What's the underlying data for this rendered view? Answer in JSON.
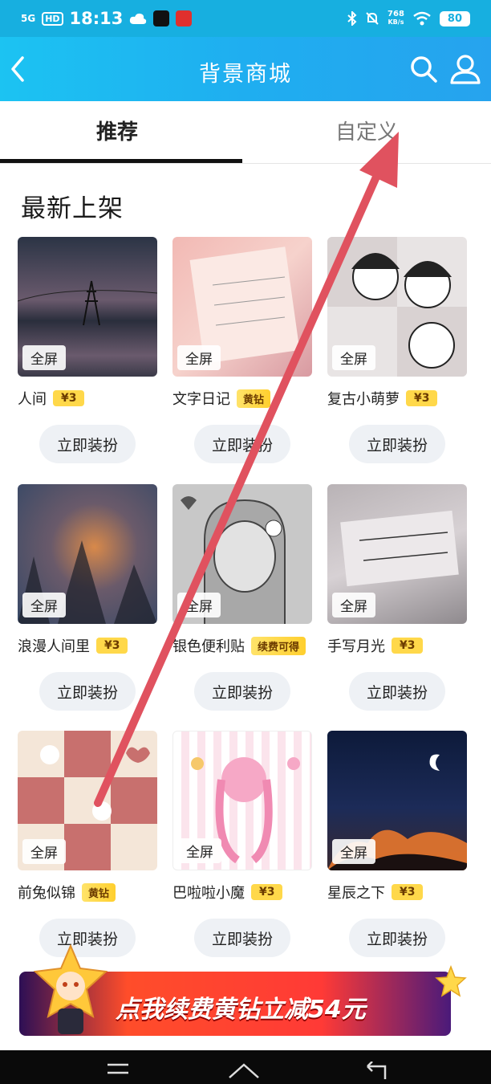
{
  "status_bar": {
    "network": "5G",
    "hd": "HD",
    "time": "18:13",
    "speed_value": "768",
    "speed_unit": "KB/s",
    "battery": "80"
  },
  "header": {
    "title": "背景商城"
  },
  "tabs": [
    {
      "label": "推荐",
      "active": true
    },
    {
      "label": "自定义",
      "active": false
    }
  ],
  "section": {
    "title": "最新上架"
  },
  "cards": [
    {
      "name": "人间",
      "badge": "全屏",
      "price": "¥3",
      "button": "立即装扮"
    },
    {
      "name": "文字日记",
      "badge": "全屏",
      "price": "黄钻",
      "button": "立即装扮"
    },
    {
      "name": "复古小萌萝",
      "badge": "全屏",
      "price": "¥3",
      "button": "立即装扮"
    },
    {
      "name": "浪漫人间里",
      "badge": "全屏",
      "price": "¥3",
      "button": "立即装扮"
    },
    {
      "name": "银色便利贴",
      "badge": "全屏",
      "price": "续费可得",
      "button": "立即装扮"
    },
    {
      "name": "手写月光",
      "badge": "全屏",
      "price": "¥3",
      "button": "立即装扮"
    },
    {
      "name": "前兔似锦",
      "badge": "全屏",
      "price": "黄钻",
      "button": "立即装扮"
    },
    {
      "name": "巴啦啦小魔",
      "badge": "全屏",
      "price": "¥3",
      "button": "立即装扮"
    },
    {
      "name": "星辰之下",
      "badge": "全屏",
      "price": "¥3",
      "button": "立即装扮"
    }
  ],
  "banner": {
    "text": "点我续费黄钻立减54元"
  },
  "colors": {
    "header_blue": "#1faef0",
    "price_yellow": "#ffd84a",
    "arrow_red": "#e0525f"
  }
}
